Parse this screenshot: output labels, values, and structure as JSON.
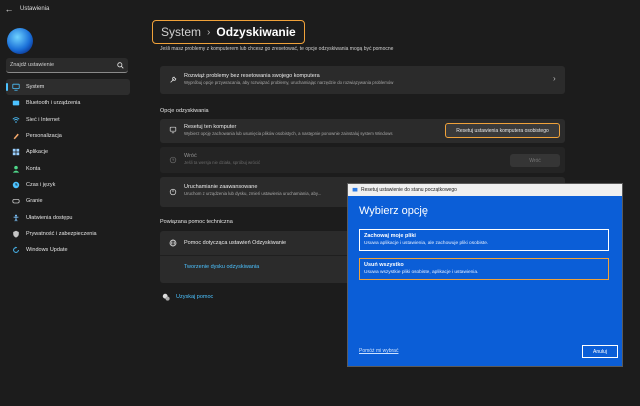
{
  "window": {
    "title": "Ustawienia",
    "back_icon": "back-arrow-icon"
  },
  "sidebar": {
    "search_placeholder": "Znajdź ustawienie",
    "items": [
      {
        "label": "System",
        "icon": "system-icon",
        "color": "#4cc2ff",
        "active": true
      },
      {
        "label": "Bluetooth i urządzenia",
        "icon": "bluetooth-icon",
        "color": "#4cc2ff"
      },
      {
        "label": "Sieć i Internet",
        "icon": "network-icon",
        "color": "#4cc2ff"
      },
      {
        "label": "Personalizacja",
        "icon": "brush-icon",
        "color": "#f5a86b"
      },
      {
        "label": "Aplikacje",
        "icon": "apps-icon",
        "color": "#9ad0ff"
      },
      {
        "label": "Konta",
        "icon": "account-icon",
        "color": "#4fd88a"
      },
      {
        "label": "Czas i język",
        "icon": "globe-clock-icon",
        "color": "#4cc2ff"
      },
      {
        "label": "Granie",
        "icon": "gamepad-icon",
        "color": "#c4c4c4"
      },
      {
        "label": "Ułatwienia dostępu",
        "icon": "accessibility-icon",
        "color": "#7fc6ff"
      },
      {
        "label": "Prywatność i zabezpieczenia",
        "icon": "shield-icon",
        "color": "#c4c4c4"
      },
      {
        "label": "Windows Update",
        "icon": "update-icon",
        "color": "#4cc2ff"
      }
    ]
  },
  "main": {
    "breadcrumb": {
      "parent": "System",
      "separator": "›",
      "current": "Odzyskiwanie"
    },
    "intro": "Jeśli masz problemy z komputerem lub chcesz go zresetować, te opcje odzyskiwania mogą być pomocne",
    "fix_card": {
      "title": "Rozwiąż problemy bez resetowania swojego komputera",
      "desc": "Wypróbuj opcje przywracania, aby rozwiązać problemy, uruchamiając narzędzie do rozwiązywania problemów"
    },
    "recovery_section": "Opcje odzyskiwania",
    "reset_card": {
      "title": "Resetuj ten komputer",
      "desc": "Wybierz opcję zachowania lub usunięcia plików osobistych, a następnie ponownie zainstaluj system Windows",
      "button": "Resetuj ustawienia komputera osobistego"
    },
    "goback_card": {
      "title": "Wróć",
      "desc": "Jeśli ta wersja nie działa, spróbuj wrócić",
      "button": "Wróć"
    },
    "advanced_card": {
      "title": "Uruchamianie zaawansowane",
      "desc": "Uruchom z urządzenia lub dysku, zmień ustawienia uruchamiania, aby..."
    },
    "help_section": "Powiązana pomoc techniczna",
    "help_card": {
      "title": "Pomoc dotycząca ustawień Odzyskiwanie",
      "link": "Tworzenie dysku odzyskiwania"
    },
    "get_help": "Uzyskaj pomoc"
  },
  "dialog": {
    "title": "Resetuj ustawienie do stanu początkowego",
    "heading": "Wybierz opcję",
    "options": [
      {
        "title": "Zachowaj moje pliki",
        "desc": "Usuwa aplikacje i ustawienia, ale zachowuje pliki osobiste."
      },
      {
        "title": "Usuń wszystko",
        "desc": "Usuwa wszystkie pliki osobiste, aplikacje i ustawienia."
      }
    ],
    "help_link": "Pomóż mi wybrać",
    "cancel": "Anuluj"
  },
  "colors": {
    "accent": "#4cc2ff",
    "highlight": "#f0a23a",
    "dialog_bg": "#0b5ed7"
  }
}
